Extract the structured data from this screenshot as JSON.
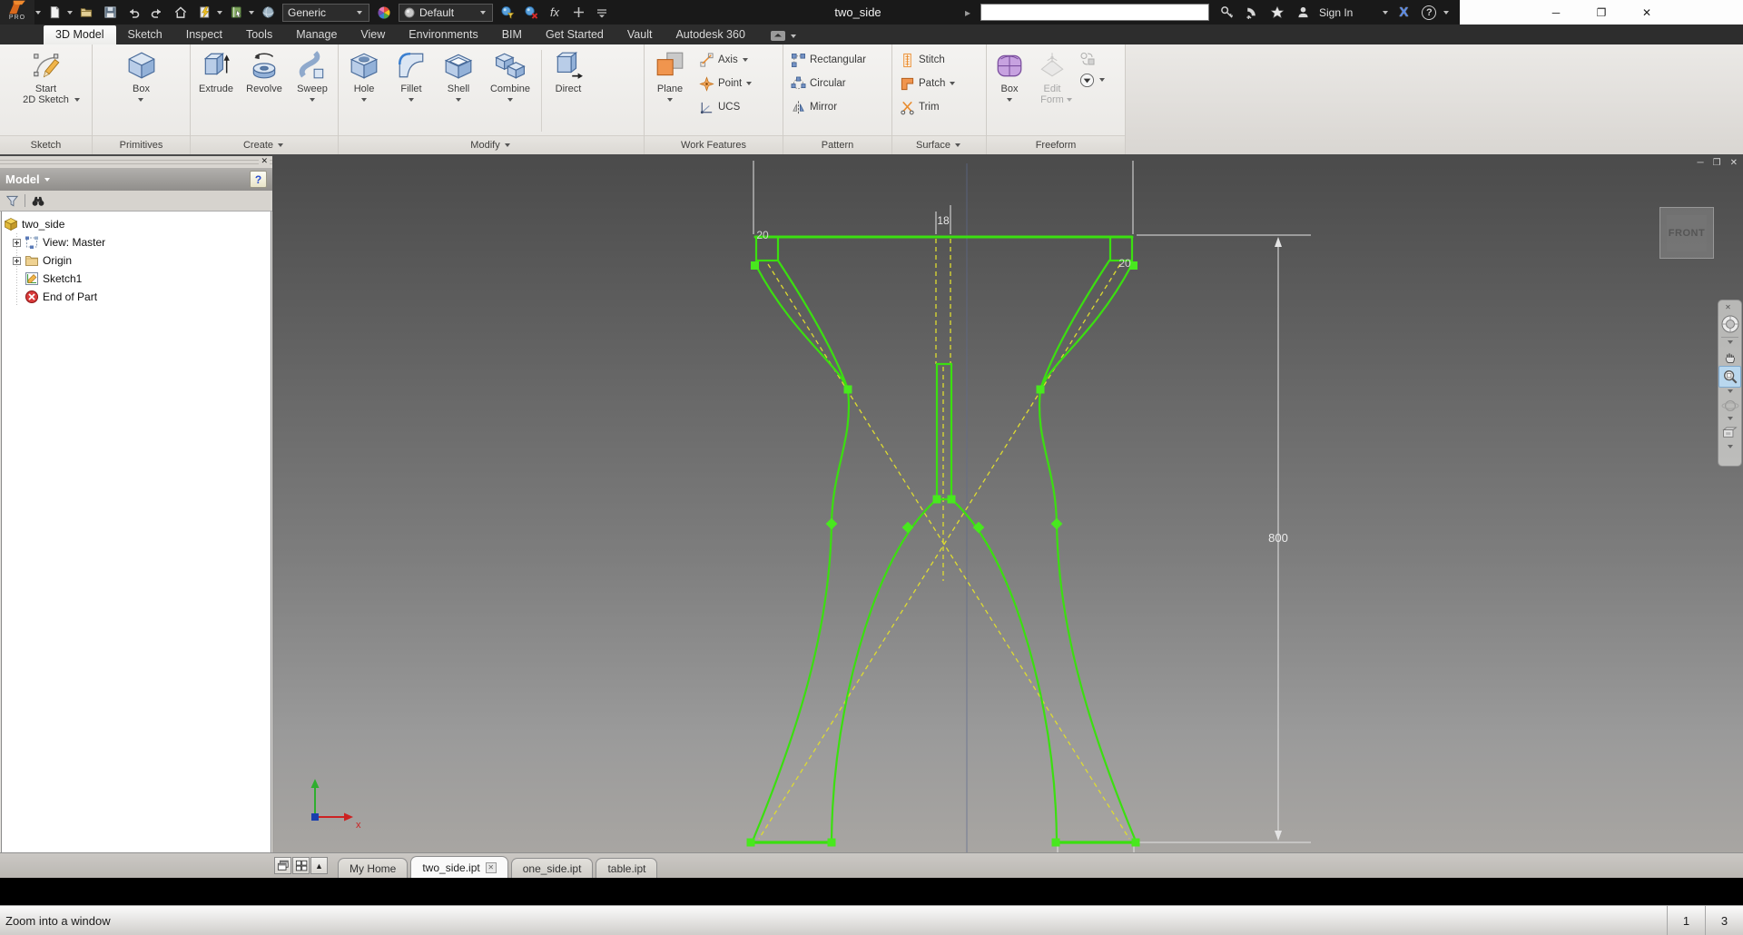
{
  "titlebar": {
    "title": "two_side",
    "app_badge": "PRO",
    "material_combo": "Generic",
    "appearance_combo": "Default",
    "sign_in_label": "Sign In",
    "search_value": ""
  },
  "glyphs": {
    "caret": "▾",
    "close": "✕",
    "minimize": "─",
    "restore": "❐",
    "help": "?",
    "fx": "fx",
    "exchange": "X",
    "prev": "▸",
    "up": "▲"
  },
  "ribbon_tabs": [
    "3D Model",
    "Sketch",
    "Inspect",
    "Tools",
    "Manage",
    "View",
    "Environments",
    "BIM",
    "Get Started",
    "Vault",
    "Autodesk 360"
  ],
  "ribbon": {
    "sketch": {
      "label": "Sketch",
      "start_line1": "Start",
      "start_line2": "2D Sketch"
    },
    "primitives": {
      "label": "Primitives",
      "box": "Box"
    },
    "create": {
      "label": "Create",
      "extrude": "Extrude",
      "revolve": "Revolve",
      "sweep": "Sweep"
    },
    "modify": {
      "label": "Modify",
      "hole": "Hole",
      "fillet": "Fillet",
      "shell": "Shell",
      "combine": "Combine",
      "direct": "Direct"
    },
    "work_features": {
      "label": "Work Features",
      "plane": "Plane",
      "axis": "Axis",
      "point": "Point",
      "ucs": "UCS"
    },
    "pattern": {
      "label": "Pattern",
      "rectangular": "Rectangular",
      "circular": "Circular",
      "mirror": "Mirror"
    },
    "surface": {
      "label": "Surface",
      "stitch": "Stitch",
      "patch": "Patch",
      "trim": "Trim"
    },
    "freeform": {
      "label": "Freeform",
      "box": "Box",
      "edit_line1": "Edit",
      "edit_line2": "Form"
    }
  },
  "browser": {
    "header": "Model",
    "tree": {
      "root": "two_side",
      "view": "View: Master",
      "origin": "Origin",
      "sketch": "Sketch1",
      "end": "End of Part"
    }
  },
  "viewport": {
    "viewcube_face": "FRONT",
    "dim_top_left": "20",
    "dim_top_center": "18",
    "dim_top_right": "20",
    "dim_height": "800",
    "axis_label_x": "x"
  },
  "doc_tabs": [
    "My Home",
    "two_side.ipt",
    "one_side.ipt",
    "table.ipt"
  ],
  "status": {
    "message": "Zoom into a window",
    "cell1": "1",
    "cell2": "3"
  },
  "colors": {
    "sketch_green": "#3bdf10",
    "construction_yellow": "#dedc30",
    "dimension_white": "#e4e4e4",
    "selection_blue": "#b9d7ee"
  }
}
